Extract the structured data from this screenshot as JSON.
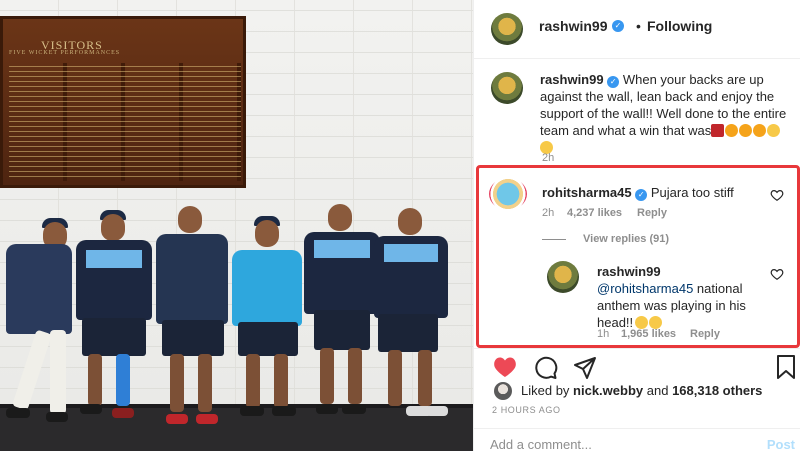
{
  "photo": {
    "board_title": "VISITORS",
    "board_subtitle": "FIVE WICKET PERFORMANCES"
  },
  "header": {
    "username": "rashwin99",
    "separator": "•",
    "follow_status": "Following"
  },
  "caption": {
    "username": "rashwin99",
    "text": "When your backs are up against the wall, lean back and enjoy the support of the wall!! Well done to the entire team and what a win that was",
    "emojis": [
      "broken-heart",
      "fire",
      "fire",
      "fire",
      "hugging-face",
      "hugging-face"
    ],
    "time": "2h"
  },
  "comments": [
    {
      "username": "rohitsharma45",
      "text": "Pujara too stiff",
      "time": "2h",
      "likes": "4,237 likes",
      "reply_label": "Reply",
      "view_replies": "View replies (91)"
    },
    {
      "username": "rashwin99",
      "mention": "@rohitsharma45",
      "text": "national anthem was playing in his head!!",
      "emojis": [
        "rofl",
        "rofl"
      ],
      "time": "1h",
      "likes": "1,965 likes",
      "reply_label": "Reply"
    }
  ],
  "likes": {
    "prefix": "Liked by",
    "user": "nick.webby",
    "and": "and",
    "count": "168,318 others"
  },
  "timestamp": "2 HOURS AGO",
  "add_comment": {
    "placeholder": "Add a comment...",
    "post_label": "Post"
  },
  "colors": {
    "verified": "#3897f0",
    "like_red": "#ed4956",
    "highlight_border": "#e8383b",
    "secondary_text": "#8e8e8e"
  }
}
